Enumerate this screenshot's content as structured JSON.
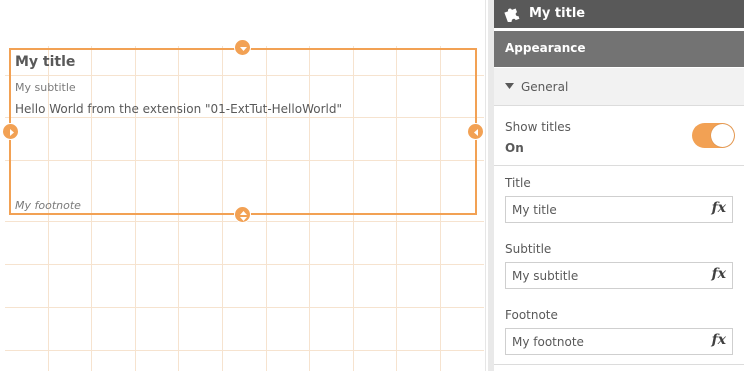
{
  "visualization": {
    "title": "My title",
    "subtitle": "My subtitle",
    "content": "Hello World from the extension \"01-ExtTut-HelloWorld\"",
    "footnote": "My footnote"
  },
  "panel": {
    "header_title": "My title",
    "header_icon": "puzzle-piece-icon",
    "section": "Appearance",
    "subsection": "General",
    "show_titles": {
      "label": "Show titles",
      "value": "On"
    },
    "fields": [
      {
        "label": "Title",
        "value": "My title"
      },
      {
        "label": "Subtitle",
        "value": "My subtitle"
      },
      {
        "label": "Footnote",
        "value": "My footnote"
      }
    ],
    "expression_label": "fx"
  },
  "colors": {
    "accent": "#f2a154",
    "header_bg": "#595959",
    "section_bg": "#737373",
    "grid": "#f6e3cf"
  }
}
